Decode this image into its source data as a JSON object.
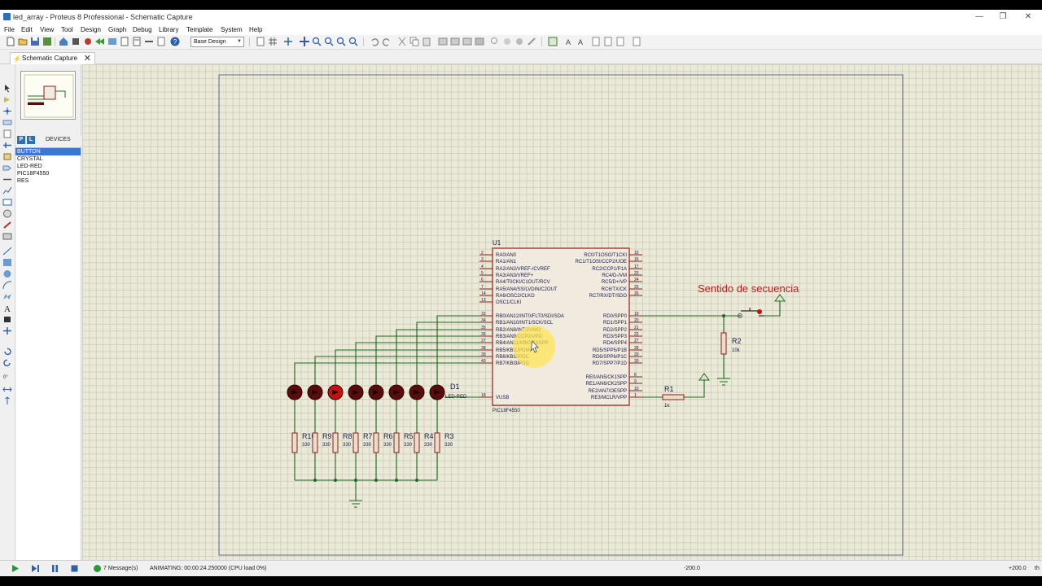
{
  "window": {
    "title": "led_array - Proteus 8 Professional - Schematic Capture",
    "minimize": "—",
    "restore": "❐",
    "close": "✕"
  },
  "menu": [
    "File",
    "Edit",
    "View",
    "Tool",
    "Design",
    "Graph",
    "Debug",
    "Library",
    "Template",
    "System",
    "Help"
  ],
  "toolbar": {
    "design_select": "Base Design",
    "icons": [
      "new-file-icon",
      "open-folder-icon",
      "save-icon",
      "import-icon",
      "home-icon",
      "parts-icon",
      "chip-icon",
      "undo-sheet-icon",
      "image-icon",
      "bom-icon",
      "report-icon",
      "gerber-icon",
      "help-icon"
    ]
  },
  "tab": {
    "label": "Schematic Capture",
    "close": "✕"
  },
  "left_panel": {
    "p_button": "P",
    "l_button": "L",
    "header": "DEVICES",
    "devices": [
      "BUTTON",
      "CRYSTAL",
      "LED-RED",
      "PIC18F4550",
      "RES"
    ],
    "selected_index": 0
  },
  "schematic": {
    "mcu": {
      "ref": "U1",
      "part": "PIC18F4550",
      "left_pins": [
        {
          "num": "2",
          "name": "RA0/AN0"
        },
        {
          "num": "3",
          "name": "RA1/AN1"
        },
        {
          "num": "4",
          "name": "RA2/AN2/VREF-/CVREF"
        },
        {
          "num": "5",
          "name": "RA3/AN3/VREF+"
        },
        {
          "num": "6",
          "name": "RA4/T0CKI/C1OUT/RCV"
        },
        {
          "num": "7",
          "name": "RA5/AN4/SS/LVDIN/C2OUT"
        },
        {
          "num": "14",
          "name": "RA6/OSC2/CLKO"
        },
        {
          "num": "13",
          "name": "OSC1/CLKI"
        },
        {
          "num": "33",
          "name": "RB0/AN12/INT0/FLT0/SDI/SDA"
        },
        {
          "num": "34",
          "name": "RB1/AN10/INT1/SCK/SCL"
        },
        {
          "num": "35",
          "name": "RB2/AN8/INT2/VMO"
        },
        {
          "num": "36",
          "name": "RB3/AN9/CCP2/VPO"
        },
        {
          "num": "37",
          "name": "RB4/AN11/KBI0/CSSPP"
        },
        {
          "num": "38",
          "name": "RB5/KBI1/PGM"
        },
        {
          "num": "39",
          "name": "RB6/KBI2/PGC"
        },
        {
          "num": "40",
          "name": "RB7/KBI3/PGD"
        },
        {
          "num": "18",
          "name": "VUSB"
        }
      ],
      "right_pins": [
        {
          "num": "15",
          "name": "RC0/T1OSO/T1CKI"
        },
        {
          "num": "16",
          "name": "RC1/T1OSI/CCP2/UOE"
        },
        {
          "num": "17",
          "name": "RC2/CCP1/P1A"
        },
        {
          "num": "23",
          "name": "RC4/D-/VM"
        },
        {
          "num": "24",
          "name": "RC5/D+/VP"
        },
        {
          "num": "25",
          "name": "RC6/TX/CK"
        },
        {
          "num": "26",
          "name": "RC7/RX/DT/SDO"
        },
        {
          "num": "19",
          "name": "RD0/SPP0"
        },
        {
          "num": "20",
          "name": "RD1/SPP1"
        },
        {
          "num": "21",
          "name": "RD2/SPP2"
        },
        {
          "num": "22",
          "name": "RD3/SPP3"
        },
        {
          "num": "27",
          "name": "RD4/SPP4"
        },
        {
          "num": "28",
          "name": "RD5/SPP5/P1B"
        },
        {
          "num": "29",
          "name": "RD6/SPP6/P1C"
        },
        {
          "num": "30",
          "name": "RD7/SPP7/P1D"
        },
        {
          "num": "8",
          "name": "RE0/AN5/CK1SPP"
        },
        {
          "num": "9",
          "name": "RE1/AN6/CK2SPP"
        },
        {
          "num": "10",
          "name": "RE2/AN7/OESPP"
        },
        {
          "num": "1",
          "name": "RE3/MCLR/VPP"
        }
      ]
    },
    "annotation": "Sentido de secuencia",
    "r1": {
      "ref": "R1",
      "value": "1k"
    },
    "r2": {
      "ref": "R2",
      "value": "10k"
    },
    "d1": {
      "ref": "D1",
      "value": "LED-RED"
    },
    "resistors": [
      {
        "ref": "R10",
        "value": "330"
      },
      {
        "ref": "R9",
        "value": "330"
      },
      {
        "ref": "R8",
        "value": "330"
      },
      {
        "ref": "R7",
        "value": "330"
      },
      {
        "ref": "R6",
        "value": "330"
      },
      {
        "ref": "R5",
        "value": "330"
      },
      {
        "ref": "R4",
        "value": "330"
      },
      {
        "ref": "R3",
        "value": "330"
      }
    ],
    "led_lit": [
      false,
      false,
      true,
      false,
      false,
      false,
      false,
      false
    ],
    "colors": {
      "wire": "#1f6a1f",
      "body": "#8b1e1e",
      "chip_fill": "#f1eadf",
      "text": "#1a1a4a",
      "led_dark": "#5a0c0c",
      "led_lit": "#c81010",
      "highlight": "#ffe64a"
    }
  },
  "status": {
    "messages": "7 Message(s)",
    "animating": "ANIMATING: 00:00:24.250000 (CPU load 0%)",
    "x": "-200.0",
    "y": "+200.0",
    "unit": "th"
  }
}
